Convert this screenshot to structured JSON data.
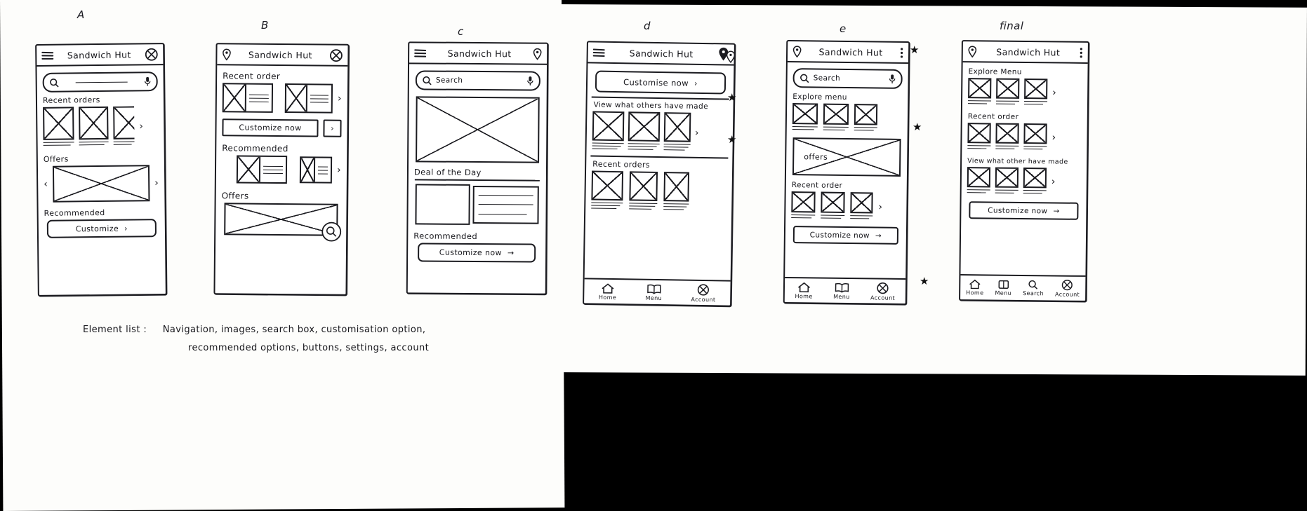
{
  "document": {
    "type": "hand-drawn wireframe sketch",
    "element_list_label": "Element list :",
    "element_list_line1": "Navigation, images, search box, customisation option,",
    "element_list_line2": "recommended options, buttons, settings, account"
  },
  "panels": [
    {
      "id": "a",
      "letter": "A",
      "header": {
        "left_icon": "hamburger-menu-icon",
        "title": "Sandwich Hut",
        "right_icon": "close-circle-icon"
      },
      "search": {
        "placeholder": "",
        "left_icon": "search-icon",
        "right_icon": "microphone-icon"
      },
      "sections": [
        {
          "label": "Recent orders",
          "type": "thumb-row",
          "count": 3,
          "chevron": "›"
        },
        {
          "label": "Offers",
          "type": "banner",
          "left_chevron": "‹",
          "right_chevron": "›"
        },
        {
          "label": "Recommended",
          "type": "button",
          "button_label": "Customize",
          "button_arrow": "›"
        }
      ]
    },
    {
      "id": "b",
      "letter": "B",
      "header": {
        "left_icon": "location-pin-icon",
        "title": "Sandwich Hut",
        "right_icon": "close-circle-icon"
      },
      "sections": [
        {
          "label": "Recent order",
          "type": "card-row",
          "count": 2,
          "chevron": "›"
        },
        {
          "label": "",
          "type": "button",
          "button_label": "Customize now",
          "button_arrow": "›"
        },
        {
          "label": "Recommended",
          "type": "card-row",
          "count": 2,
          "chevron": "›"
        },
        {
          "label": "Offers",
          "type": "banner-search",
          "icon": "search-icon"
        }
      ]
    },
    {
      "id": "c",
      "letter": "c",
      "header": {
        "left_icon": "hamburger-menu-icon",
        "title": "Sandwich Hut",
        "right_icon": "location-pin-icon"
      },
      "search": {
        "placeholder": "Search",
        "left_icon": "search-icon",
        "right_icon": "microphone-icon"
      },
      "sections": [
        {
          "label": "",
          "type": "hero-banner"
        },
        {
          "label": "Deal of the Day",
          "type": "deal-card"
        },
        {
          "label": "Recommended",
          "type": "button",
          "button_label": "Customize now",
          "button_arrow": "→"
        }
      ]
    },
    {
      "id": "d",
      "letter": "d",
      "header": {
        "left_icon": "hamburger-menu-icon",
        "title": "Sandwich Hut",
        "right_icon": "location-pin-icon"
      },
      "sections": [
        {
          "label": "",
          "type": "button",
          "button_label": "Customise now",
          "button_arrow": "›"
        },
        {
          "label": "View what others have made",
          "type": "thumb-row",
          "count": 3,
          "chevron": "›"
        },
        {
          "label": "Recent orders",
          "type": "thumb-row",
          "count": 3,
          "chevron": ""
        }
      ],
      "navbar": [
        {
          "icon": "home-icon",
          "label": "Home"
        },
        {
          "icon": "menu-book-icon",
          "label": "Menu"
        },
        {
          "icon": "account-circle-icon",
          "label": "Account"
        }
      ],
      "annotations": [
        "★",
        "★"
      ]
    },
    {
      "id": "e",
      "letter": "e",
      "header": {
        "left_icon": "location-pin-icon",
        "title": "Sandwich Hut",
        "right_icon": "kebab-menu-icon"
      },
      "search": {
        "placeholder": "Search",
        "left_icon": "search-icon",
        "right_icon": "microphone-icon"
      },
      "sections": [
        {
          "label": "Explore menu",
          "type": "thumb-row",
          "count": 3,
          "chevron": ""
        },
        {
          "label": "",
          "type": "offers-banner",
          "banner_text": "offers"
        },
        {
          "label": "Recent order",
          "type": "thumb-row",
          "count": 3,
          "chevron": "›"
        },
        {
          "label": "",
          "type": "button",
          "button_label": "Customize now",
          "button_arrow": "→"
        }
      ],
      "navbar": [
        {
          "icon": "home-icon",
          "label": "Home"
        },
        {
          "icon": "menu-book-icon",
          "label": "Menu"
        },
        {
          "icon": "account-circle-icon",
          "label": "Account"
        }
      ],
      "annotations": [
        "★",
        "★",
        "★"
      ]
    },
    {
      "id": "final",
      "letter": "final",
      "header": {
        "left_icon": "location-pin-icon",
        "title": "Sandwich Hut",
        "right_icon": "kebab-menu-icon"
      },
      "sections": [
        {
          "label": "Explore Menu",
          "type": "thumb-row",
          "count": 3,
          "chevron": "›"
        },
        {
          "label": "Recent order",
          "type": "thumb-row",
          "count": 3,
          "chevron": "›"
        },
        {
          "label": "View what other have made",
          "type": "thumb-row",
          "count": 3,
          "chevron": "›"
        },
        {
          "label": "",
          "type": "button",
          "button_label": "Customize now",
          "button_arrow": "→"
        }
      ],
      "navbar": [
        {
          "icon": "home-icon",
          "label": "Home"
        },
        {
          "icon": "menu-book-icon",
          "label": "Menu"
        },
        {
          "icon": "search-icon",
          "label": "Search"
        },
        {
          "icon": "account-circle-icon",
          "label": "Account"
        }
      ]
    }
  ],
  "colors": {
    "ink": "#15151a",
    "paper": "#fdfdfb",
    "background": "#000000"
  }
}
